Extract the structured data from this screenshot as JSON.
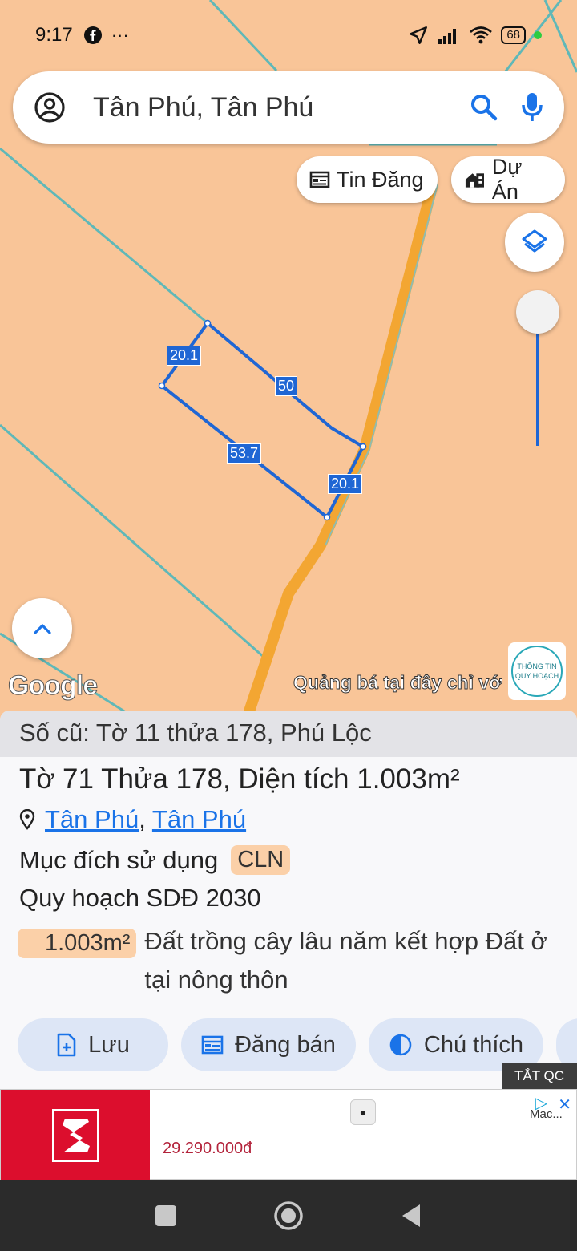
{
  "status_bar": {
    "time": "9:17",
    "battery": "68",
    "extra": "···"
  },
  "search": {
    "query": "Tân Phú, Tân Phú"
  },
  "chips": {
    "listings": "Tin Đăng",
    "projects": "Dự Án"
  },
  "map": {
    "segment_labels": [
      "20.1",
      "50",
      "53.7",
      "20.1"
    ],
    "google_logo": "Google",
    "ad_overlay": "Quảng bá tại đây chỉ vớ",
    "planning_badge": {
      "line1": "THÔNG TIN",
      "line2": "QUY HOẠCH"
    }
  },
  "panel": {
    "old_ref": "Số cũ: Tờ 11 thửa 178, Phú Lộc",
    "parcel_title": "Tờ 71 Thửa 178, Diện tích 1.003m²",
    "location": {
      "link1": "Tân Phú",
      "sep": ",",
      "link2": "Tân Phú"
    },
    "purpose_label": "Mục đích sử dụng",
    "purpose_code": "CLN",
    "plan_label": "Quy hoạch SDĐ 2030",
    "area_value": "1.003m²",
    "land_desc": "Đất trồng cây lâu năm kết hợp Đất ở tại nông thôn",
    "actions": {
      "save": "Lưu",
      "post_sale": "Đăng bán",
      "legend": "Chú thích"
    }
  },
  "ad": {
    "off_label": "TẮT QC",
    "price": "29.290.000đ",
    "product_label": "Mac..."
  },
  "colors": {
    "accent": "#1a73e8",
    "parcel_line": "#1f66d4",
    "road": "#f3a632",
    "map_bg": "#f9c598"
  }
}
